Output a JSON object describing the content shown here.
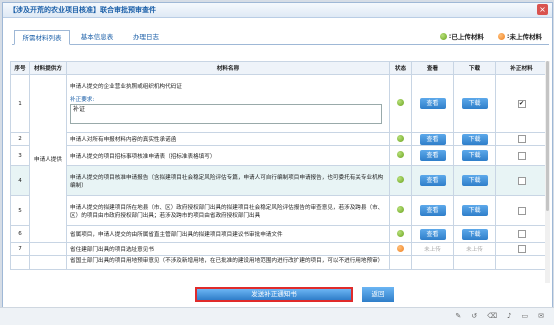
{
  "title": "【涉及开荒的农业项目核准】联合审批预审查件",
  "tabs": [
    {
      "label": "所需材料列表"
    },
    {
      "label": "基本信息表"
    },
    {
      "label": "办理日志"
    }
  ],
  "legend": {
    "uploaded": "已上传材料",
    "not_uploaded": "未上传材料"
  },
  "headers": {
    "seq": "序号",
    "provider": "材料提供方",
    "name": "材料名称",
    "status": "状态",
    "view": "查看",
    "download": "下载",
    "supplement": "补正材料"
  },
  "provider": "申请人提供",
  "buttons": {
    "view": "查看",
    "download": "下载",
    "not_uploaded": "未上传"
  },
  "row1": {
    "seq": "1",
    "name": "申请人提交的企业营业执照或组织机构代码证",
    "req_label": "补正要求:",
    "remark": "补证"
  },
  "row2": {
    "seq": "2",
    "name": "申请人对所有申报材料内容的真实性承诺函"
  },
  "row3": {
    "seq": "3",
    "name": "申请人提交的项目招标事项核准申请表（招标准表格填写）"
  },
  "row4": {
    "seq": "4",
    "name": "申请人提交的项目核准申请报告（含拟建项目社会稳定风险评估专篇，申请人可自行编制项目申请报告，也可委托有关专业机构编制）"
  },
  "row5": {
    "seq": "5",
    "name": "申请人提交的拟建项目所在地县（市、区）政府授权部门出具的拟建项目社会稳定风险评估报告的审查意见，若涉及跨县（市、区）的项目由市政府授权部门出具；若涉及跨市的项目由省政府授权部门出具"
  },
  "row6": {
    "seq": "6",
    "name": "省属项目，申请人提交的由所属省直主管部门出具的拟建项目项目建议书审批申请文件"
  },
  "row7": {
    "seq": "7",
    "name": "省住建部门出具的项目选址意见书"
  },
  "row8": {
    "name": "省国土部门出具的项目用地预审意见（不涉及新增用地，在已批准的建设用地范围内进行改扩建的项目，可以不进行用地预审）"
  },
  "footer": {
    "send": "发送补正通知书",
    "back": "返回"
  },
  "colors": {
    "accent": "#2f7ec9",
    "uploaded": "#6aa41f",
    "not_uploaded": "#f07f1f",
    "highlight_border": "#e02b2b"
  }
}
